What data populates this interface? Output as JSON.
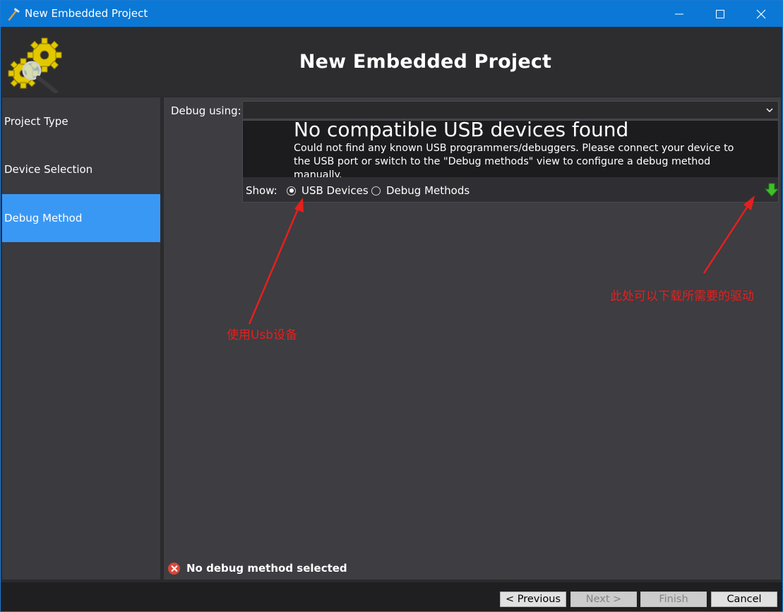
{
  "window": {
    "title": "New Embedded Project",
    "controls": {
      "minimize": "minimize-icon",
      "maximize": "maximize-icon",
      "close": "close-icon"
    }
  },
  "header": {
    "title": "New Embedded Project",
    "logo_icon": "gears-magnifier-icon"
  },
  "sidebar": {
    "items": [
      {
        "label": "Project Type",
        "active": false
      },
      {
        "label": "Device Selection",
        "active": false
      },
      {
        "label": "Debug Method",
        "active": true
      }
    ]
  },
  "main": {
    "debug_label": "Debug using:",
    "debug_value": "",
    "popup": {
      "title": "No compatible USB devices found",
      "description": "Could not find any known USB programmers/debuggers. Please connect your device to the USB port or switch to the \"Debug methods\" view to configure a debug method manually.",
      "show_label": "Show:",
      "options": [
        {
          "label": "USB Devices",
          "selected": true
        },
        {
          "label": "Debug Methods",
          "selected": false
        }
      ],
      "download_icon": "green-down-arrow-icon"
    },
    "status": {
      "text": "No debug method selected",
      "icon": "error-icon"
    }
  },
  "annotations": {
    "usb_note": "使用Usb设备",
    "driver_note": "此处可以下载所需要的驱动",
    "color": "#e5201d"
  },
  "footer": {
    "previous": "< Previous",
    "next": "Next >",
    "finish": "Finish",
    "cancel": "Cancel"
  },
  "colors": {
    "titlebar": "#0b78d6",
    "active_nav": "#3a98f5",
    "background": "#2d2d30"
  }
}
